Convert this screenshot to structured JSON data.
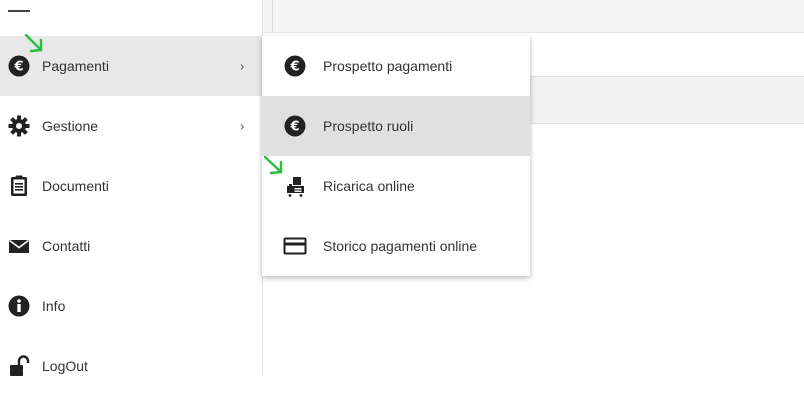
{
  "colors": {
    "accent_arrow": "#2bbf3f",
    "active_bg": "#e8e8e8",
    "hover_bg": "#e0e0e0"
  },
  "sidebar": {
    "items": [
      {
        "label": "Pagamenti",
        "icon": "euro-icon",
        "has_submenu": true,
        "active": true
      },
      {
        "label": "Gestione",
        "icon": "gear-icon",
        "has_submenu": true
      },
      {
        "label": "Documenti",
        "icon": "clipboard-icon",
        "has_submenu": false
      },
      {
        "label": "Contatti",
        "icon": "envelope-icon",
        "has_submenu": false
      },
      {
        "label": "Info",
        "icon": "info-icon",
        "has_submenu": false
      },
      {
        "label": "LogOut",
        "icon": "unlock-icon",
        "has_submenu": false
      }
    ]
  },
  "submenu": {
    "items": [
      {
        "label": "Prospetto pagamenti",
        "icon": "euro-icon"
      },
      {
        "label": "Prospetto ruoli",
        "icon": "euro-icon",
        "hover": true
      },
      {
        "label": "Ricarica online",
        "icon": "pos-terminal-icon"
      },
      {
        "label": "Storico pagamenti online",
        "icon": "credit-card-icon"
      }
    ]
  }
}
